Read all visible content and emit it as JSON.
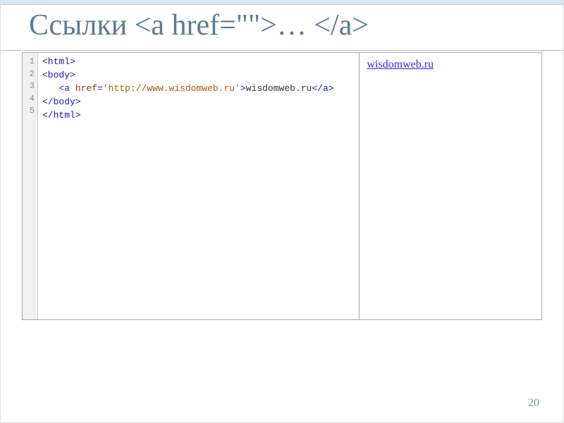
{
  "slide": {
    "title": "Ссылки <a href=\"\">… </a>",
    "page_number": "20"
  },
  "code": {
    "gutter": [
      "1",
      "2",
      "3",
      "4",
      "5"
    ],
    "lines": {
      "l1_open": "<html>",
      "l2_open": "<body>",
      "l3_indent": "   ",
      "l3_openA": "<a ",
      "l3_attr": "href",
      "l3_eq": "=",
      "l3_q1": "'",
      "l3_url": "http://www.wisdomweb.ru",
      "l3_q2": "'",
      "l3_close": ">",
      "l3_text": "wisdomweb.ru",
      "l3_closeA": "</a>",
      "l4": "</body>",
      "l5": "</html>"
    }
  },
  "preview": {
    "link_text": "wisdomweb.ru"
  }
}
